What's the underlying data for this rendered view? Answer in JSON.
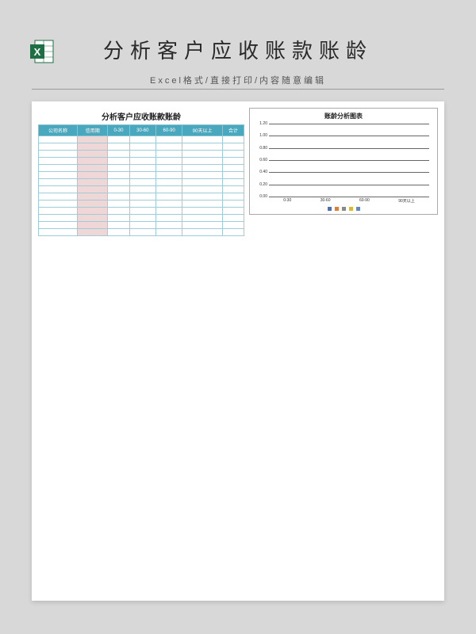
{
  "header": {
    "title": "分析客户应收账款账龄",
    "subtitle": "Excel格式/直接打印/内容随意编辑",
    "icon_name": "excel-icon"
  },
  "table": {
    "title": "分析客户应收账款账龄",
    "columns": [
      "公司名称",
      "信用期",
      "0-30",
      "30-60",
      "60-90",
      "90天以上",
      "合计"
    ],
    "row_count": 14
  },
  "chart_data": {
    "type": "bar",
    "title": "账龄分析图表",
    "categories": [
      "0-30",
      "30-60",
      "60-90",
      "90天以上"
    ],
    "values": [
      0,
      0,
      0,
      0
    ],
    "ylim": [
      0,
      1.2
    ],
    "yticks": [
      0.0,
      0.2,
      0.4,
      0.6,
      0.8,
      1.0,
      1.2
    ],
    "legend_colors": [
      "#4a72b8",
      "#d97f3e",
      "#8a8a8a",
      "#d6b93a",
      "#5e8ac6"
    ]
  },
  "colors": {
    "header_bg": "#4aa8be",
    "credit_bg": "#efd7d7",
    "page_bg": "#d8d8d8"
  }
}
